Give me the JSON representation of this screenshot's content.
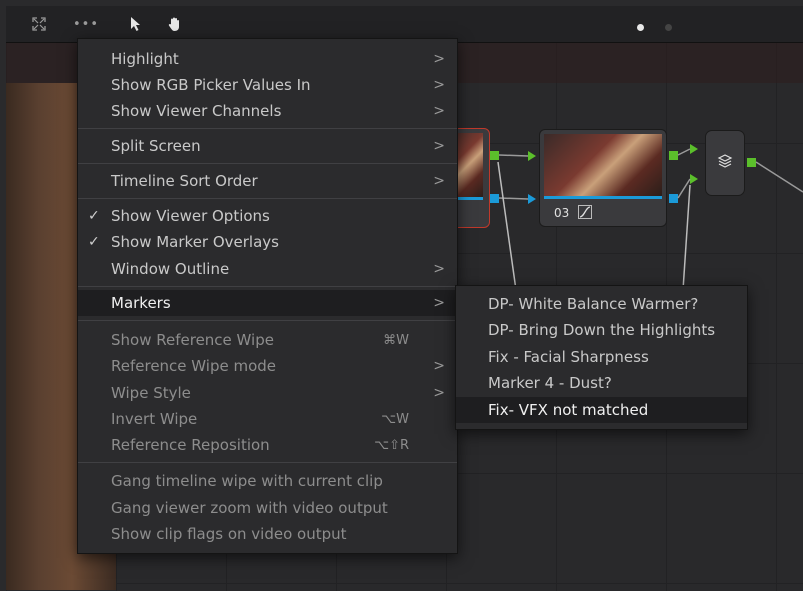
{
  "toolbar": {
    "expand_icon": "expand-arrows-icon",
    "more_label": "•••",
    "pointer_icon": "pointer-arrow-icon",
    "hand_icon": "hand-icon"
  },
  "nodes": [
    {
      "label": "03",
      "curve_icon": "curve-icon"
    }
  ],
  "menu": {
    "items": [
      {
        "label": "Highlight",
        "submenu": true
      },
      {
        "label": "Show RGB Picker Values In",
        "submenu": true
      },
      {
        "label": "Show Viewer Channels",
        "submenu": true
      },
      {
        "label": "Split Screen",
        "submenu": true
      },
      {
        "label": "Timeline Sort Order",
        "submenu": true
      },
      {
        "label": "Show Viewer Options",
        "checked": true
      },
      {
        "label": "Show Marker Overlays",
        "checked": true
      },
      {
        "label": "Window Outline",
        "submenu": true
      },
      {
        "label": "Markers",
        "submenu": true,
        "highlighted": true
      },
      {
        "label": "Show Reference Wipe",
        "shortcut": "⌘W"
      },
      {
        "label": "Reference Wipe mode",
        "submenu": true
      },
      {
        "label": "Wipe Style",
        "submenu": true
      },
      {
        "label": "Invert Wipe",
        "shortcut": "⌥W"
      },
      {
        "label": "Reference Reposition",
        "shortcut": "⌥⇧R"
      },
      {
        "label": "Gang timeline wipe with current clip"
      },
      {
        "label": "Gang viewer zoom with video output"
      },
      {
        "label": "Show clip flags on video output"
      }
    ],
    "chevron": ">",
    "checkmark": "✓"
  },
  "markers_submenu": {
    "items": [
      {
        "label": "DP- White Balance Warmer?"
      },
      {
        "label": "DP- Bring Down the Highlights"
      },
      {
        "label": "Fix - Facial Sharpness"
      },
      {
        "label": "Marker 4 - Dust?"
      },
      {
        "label": "Fix- VFX not matched",
        "highlighted": true
      }
    ]
  },
  "colors": {
    "accent_green": "#5bbf2b",
    "accent_blue": "#1b9ad8",
    "selected_node_border": "#c0392b"
  }
}
